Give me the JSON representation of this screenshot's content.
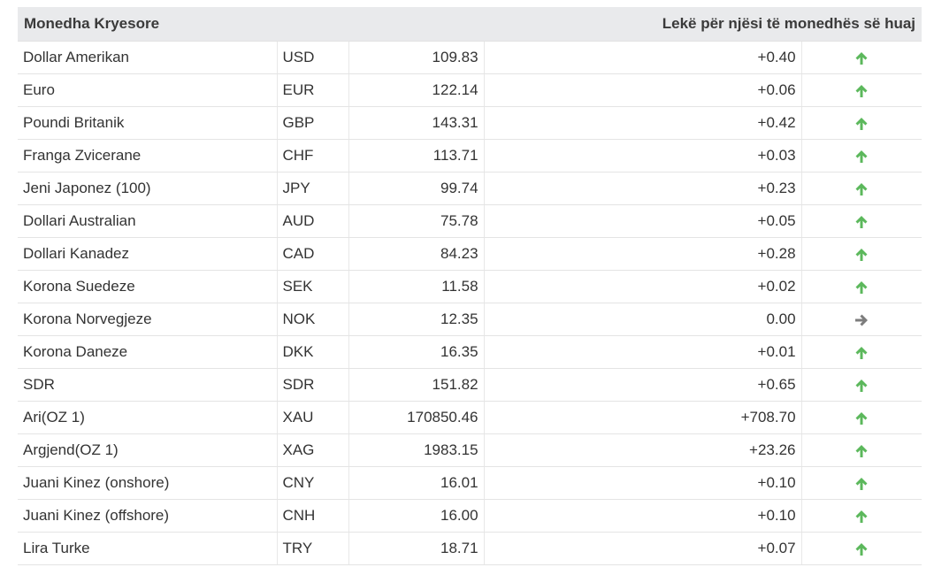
{
  "header": {
    "title": "Monedha Kryesore",
    "unit_note": "Lekë për njësi të monedhës së huaj"
  },
  "colors": {
    "up": "#5cb85c",
    "flat": "#7d7d7d"
  },
  "rows": [
    {
      "name": "Dollar Amerikan",
      "code": "USD",
      "rate": "109.83",
      "change": "+0.40",
      "trend": "up"
    },
    {
      "name": "Euro",
      "code": "EUR",
      "rate": "122.14",
      "change": "+0.06",
      "trend": "up"
    },
    {
      "name": "Poundi Britanik",
      "code": "GBP",
      "rate": "143.31",
      "change": "+0.42",
      "trend": "up"
    },
    {
      "name": "Franga Zvicerane",
      "code": "CHF",
      "rate": "113.71",
      "change": "+0.03",
      "trend": "up"
    },
    {
      "name": "Jeni Japonez (100)",
      "code": "JPY",
      "rate": "99.74",
      "change": "+0.23",
      "trend": "up"
    },
    {
      "name": "Dollari Australian",
      "code": "AUD",
      "rate": "75.78",
      "change": "+0.05",
      "trend": "up"
    },
    {
      "name": "Dollari Kanadez",
      "code": "CAD",
      "rate": "84.23",
      "change": "+0.28",
      "trend": "up"
    },
    {
      "name": "Korona Suedeze",
      "code": "SEK",
      "rate": "11.58",
      "change": "+0.02",
      "trend": "up"
    },
    {
      "name": "Korona Norvegjeze",
      "code": "NOK",
      "rate": "12.35",
      "change": "0.00",
      "trend": "flat"
    },
    {
      "name": "Korona Daneze",
      "code": "DKK",
      "rate": "16.35",
      "change": "+0.01",
      "trend": "up"
    },
    {
      "name": "SDR",
      "code": "SDR",
      "rate": "151.82",
      "change": "+0.65",
      "trend": "up"
    },
    {
      "name": "Ari(OZ 1)",
      "code": "XAU",
      "rate": "170850.46",
      "change": "+708.70",
      "trend": "up"
    },
    {
      "name": "Argjend(OZ 1)",
      "code": "XAG",
      "rate": "1983.15",
      "change": "+23.26",
      "trend": "up"
    },
    {
      "name": "Juani Kinez (onshore)",
      "code": "CNY",
      "rate": "16.01",
      "change": "+0.10",
      "trend": "up"
    },
    {
      "name": "Juani Kinez (offshore)",
      "code": "CNH",
      "rate": "16.00",
      "change": "+0.10",
      "trend": "up"
    },
    {
      "name": "Lira Turke",
      "code": "TRY",
      "rate": "18.71",
      "change": "+0.07",
      "trend": "up"
    }
  ]
}
